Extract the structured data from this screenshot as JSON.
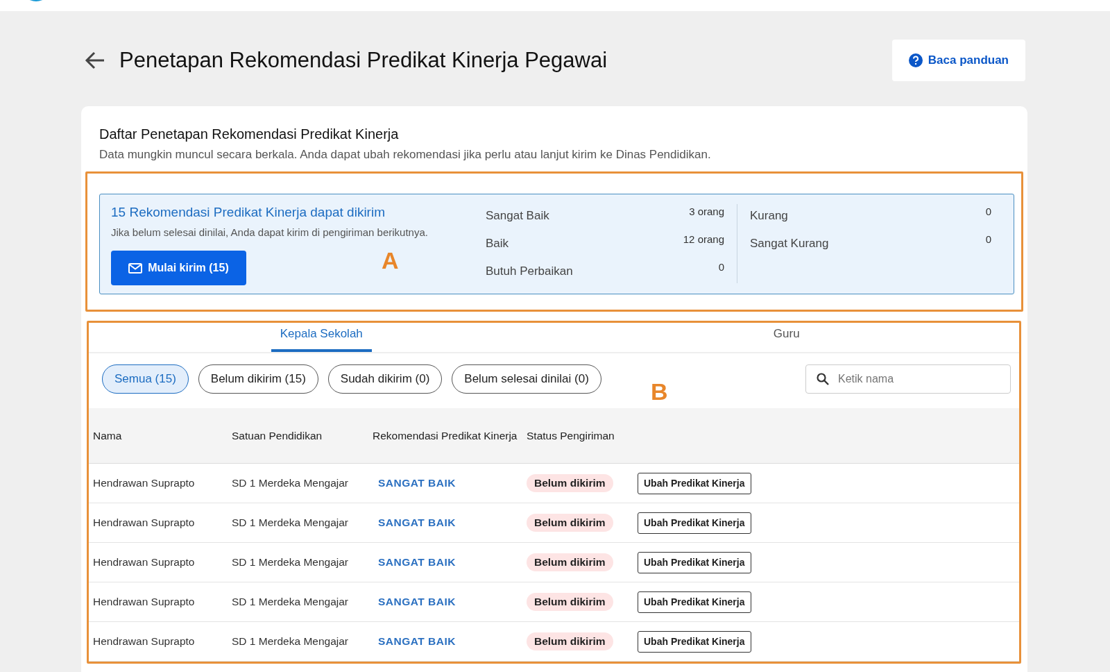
{
  "header": {
    "title": "Penetapan Rekomendasi Predikat Kinerja Pegawai",
    "guide_button": "Baca panduan"
  },
  "card": {
    "title": "Daftar Penetapan Rekomendasi Predikat Kinerja",
    "subtitle": "Data mungkin muncul secara berkala. Anda dapat ubah rekomendasi jika perlu atau lanjut kirim ke Dinas Pendidikan."
  },
  "summary": {
    "headline": "15 Rekomendasi Predikat Kinerja dapat dikirim",
    "note": "Jika belum selesai dinilai, Anda dapat kirim di pengiriman berikutnya.",
    "send_button": "Mulai kirim (15)",
    "counts_left": [
      {
        "label": "Sangat Baik",
        "value": "3 orang"
      },
      {
        "label": "Baik",
        "value": "12 orang"
      },
      {
        "label": "Butuh Perbaikan",
        "value": "0"
      }
    ],
    "counts_right": [
      {
        "label": "Kurang",
        "value": "0"
      },
      {
        "label": "Sangat Kurang",
        "value": "0"
      }
    ]
  },
  "tabs": [
    {
      "label": "Kepala Sekolah",
      "selected": true
    },
    {
      "label": "Guru",
      "selected": false
    }
  ],
  "filters": [
    {
      "label": "Semua (15)",
      "selected": true
    },
    {
      "label": "Belum dikirim (15)",
      "selected": false
    },
    {
      "label": "Sudah dikirim (0)",
      "selected": false
    },
    {
      "label": "Belum selesai dinilai (0)",
      "selected": false
    }
  ],
  "search": {
    "placeholder": "Ketik nama"
  },
  "table": {
    "columns": [
      "Nama",
      "Satuan Pendidikan",
      "Rekomendasi Predikat Kinerja",
      "Status Pengiriman"
    ],
    "rows": [
      {
        "name": "Hendrawan Suprapto",
        "school": "SD 1 Merdeka Mengajar",
        "recommendation": "SANGAT BAIK",
        "status": "Belum dikirim",
        "action": "Ubah Predikat Kinerja"
      },
      {
        "name": "Hendrawan Suprapto",
        "school": "SD 1 Merdeka Mengajar",
        "recommendation": "SANGAT BAIK",
        "status": "Belum dikirim",
        "action": "Ubah Predikat Kinerja"
      },
      {
        "name": "Hendrawan Suprapto",
        "school": "SD 1 Merdeka Mengajar",
        "recommendation": "SANGAT BAIK",
        "status": "Belum dikirim",
        "action": "Ubah Predikat Kinerja"
      },
      {
        "name": "Hendrawan Suprapto",
        "school": "SD 1 Merdeka Mengajar",
        "recommendation": "SANGAT BAIK",
        "status": "Belum dikirim",
        "action": "Ubah Predikat Kinerja"
      },
      {
        "name": "Hendrawan Suprapto",
        "school": "SD 1 Merdeka Mengajar",
        "recommendation": "SANGAT BAIK",
        "status": "Belum dikirim",
        "action": "Ubah Predikat Kinerja"
      }
    ]
  },
  "annotations": [
    {
      "label": "A"
    },
    {
      "label": "B"
    }
  ]
}
